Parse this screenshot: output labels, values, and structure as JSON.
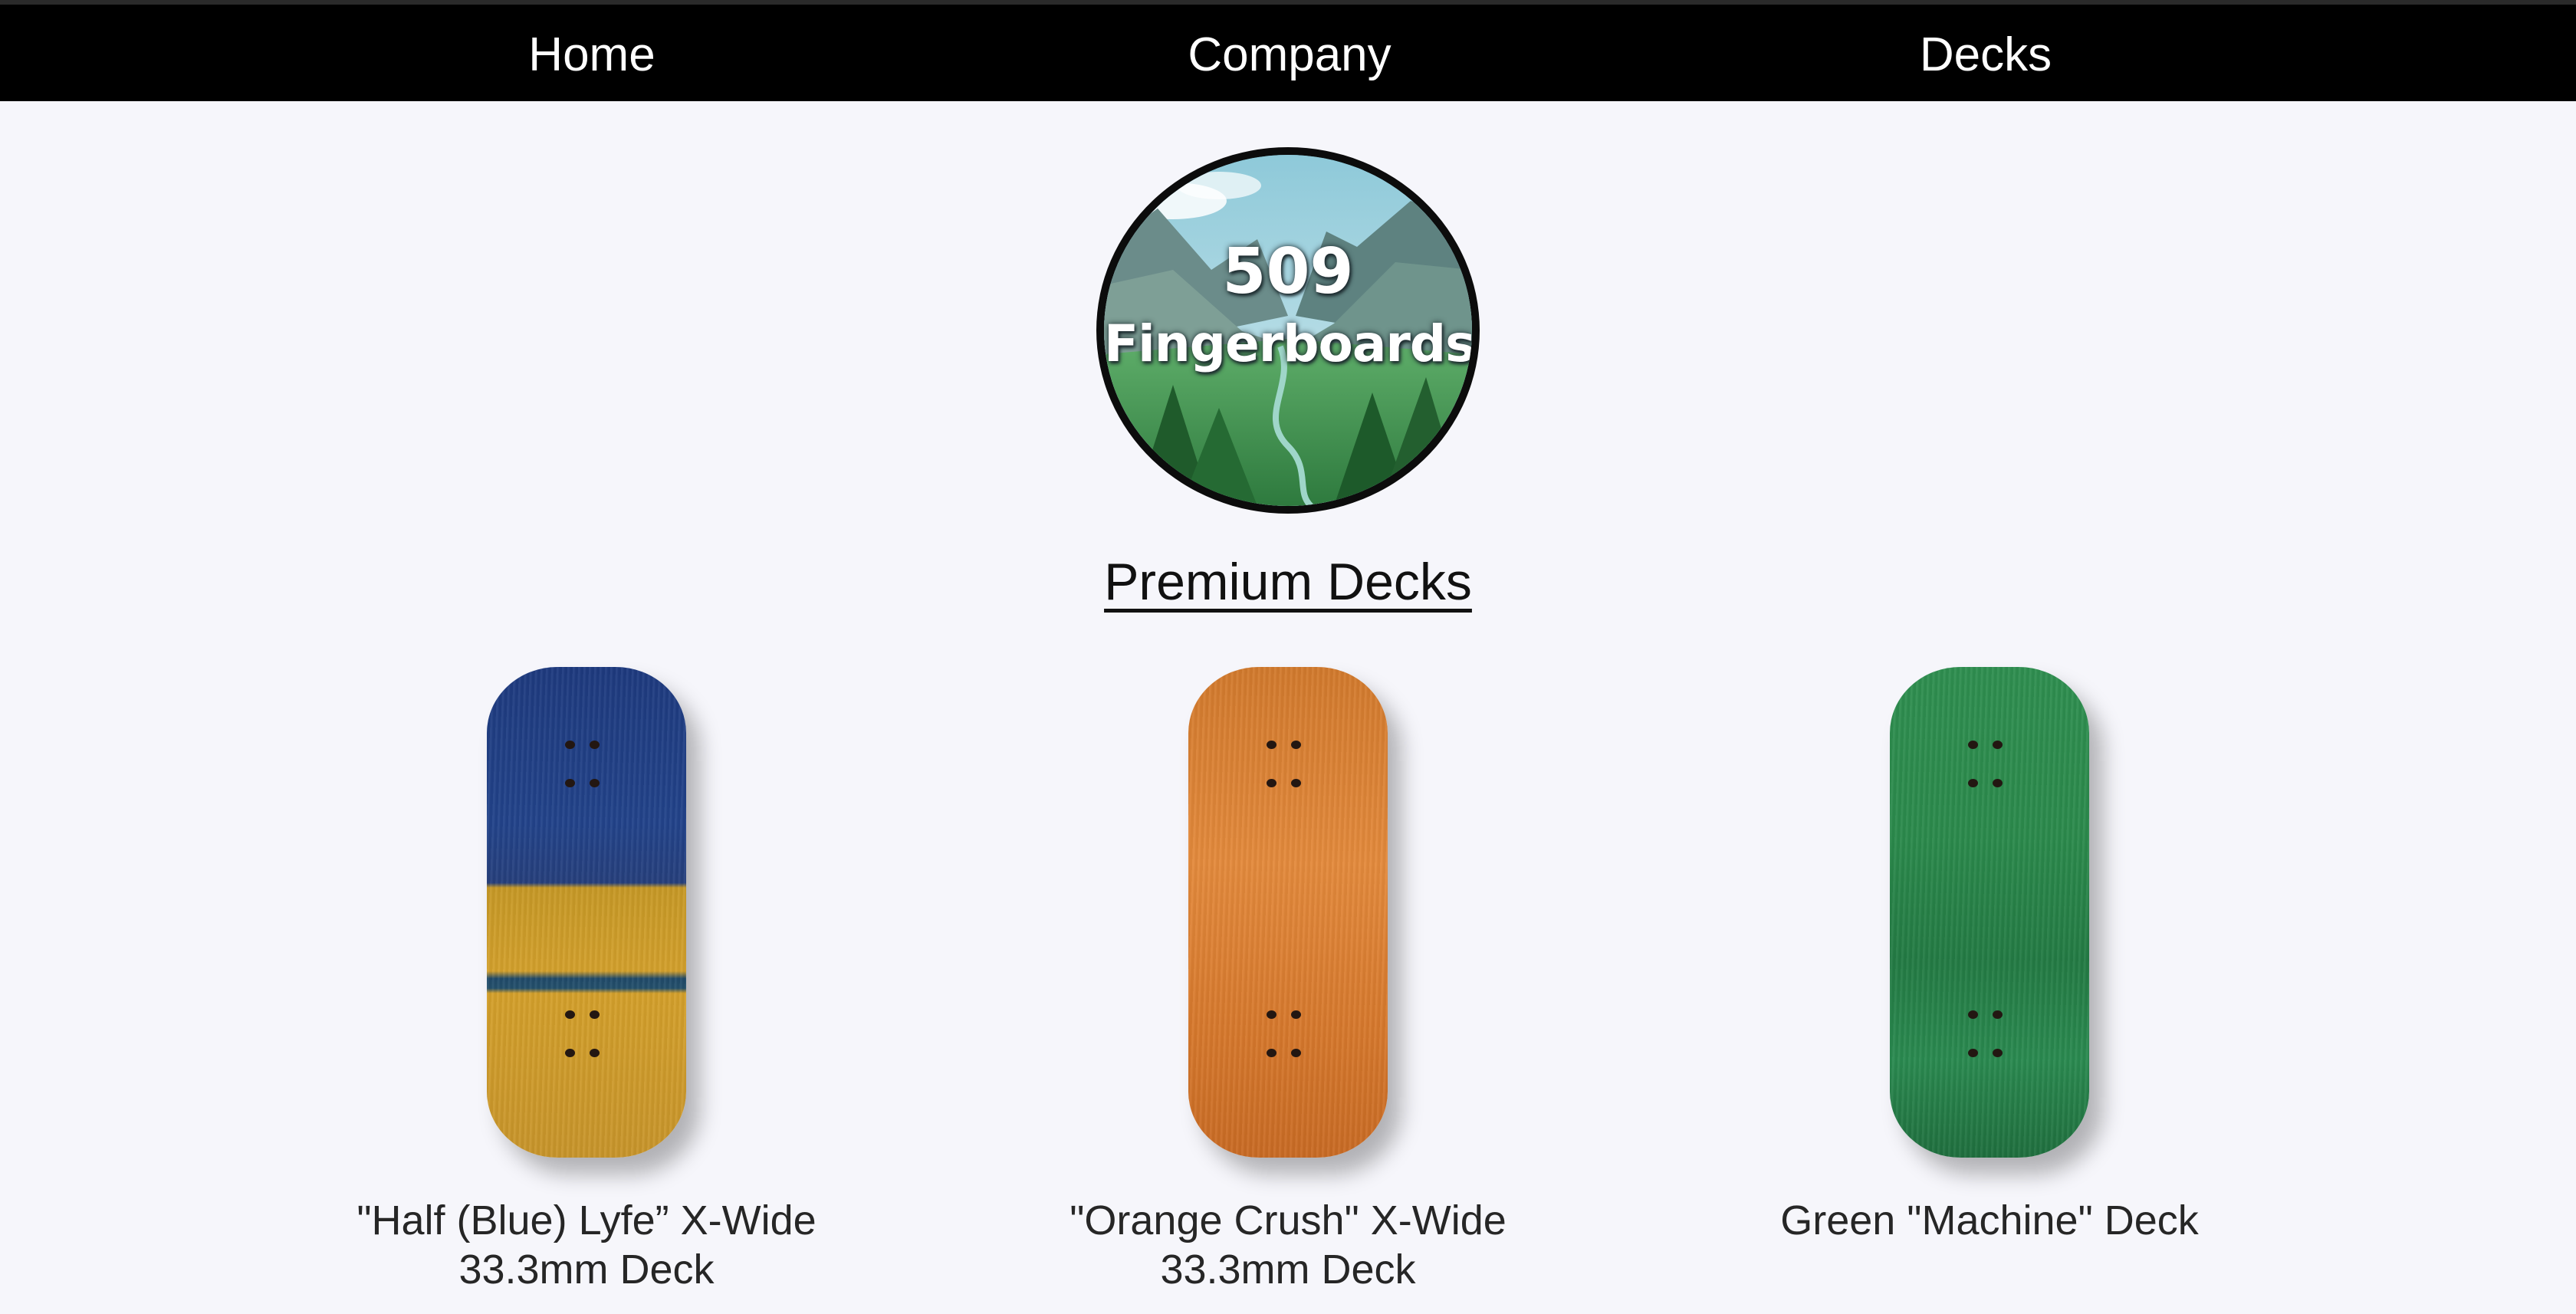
{
  "nav": {
    "items": [
      {
        "label": "Home"
      },
      {
        "label": "Company"
      },
      {
        "label": "Decks"
      }
    ]
  },
  "logo": {
    "line1": "509",
    "line2": "Fingerboards"
  },
  "section": {
    "title": "Premium Decks"
  },
  "products": [
    {
      "name_line1": "\"Half (Blue) Lyfe” X-Wide",
      "name_line2": "33.3mm Deck",
      "deck_color": "blue-yellow"
    },
    {
      "name_line1": "\"Orange Crush\" X-Wide",
      "name_line2": "33.3mm Deck",
      "deck_color": "orange"
    },
    {
      "name_line1": "Green \"Machine\" Deck",
      "name_line2": "",
      "deck_color": "green"
    }
  ],
  "colors": {
    "nav_background": "#000000",
    "page_background": "#f6f6fb",
    "text": "#262626"
  }
}
